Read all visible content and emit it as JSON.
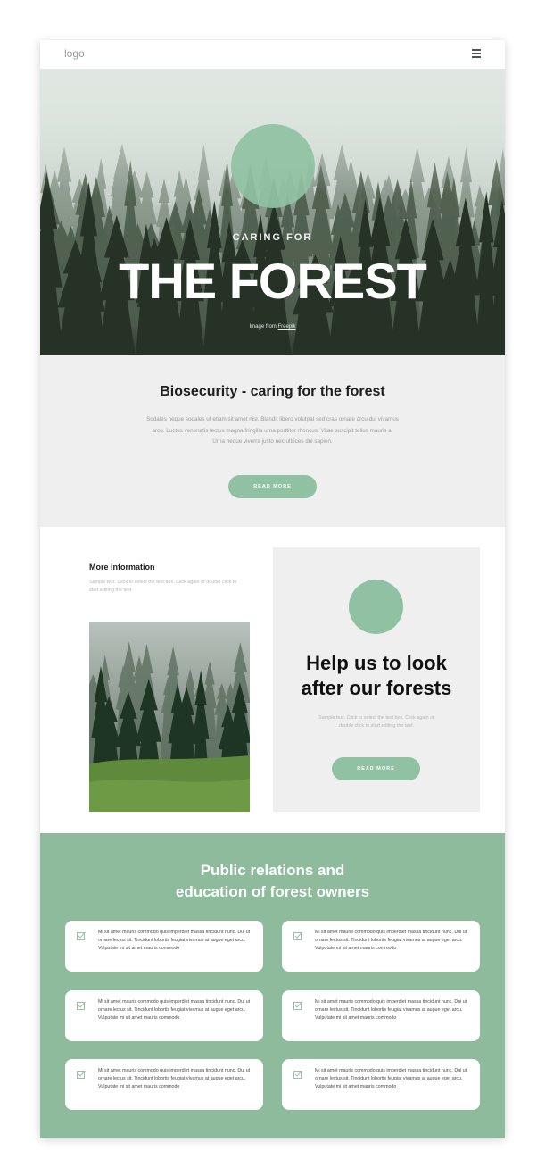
{
  "header": {
    "logo": "logo",
    "menu_icon": "hamburger-icon"
  },
  "hero": {
    "kicker": "CARING FOR",
    "title": "THE FOREST",
    "credit_prefix": "Image from",
    "credit_link": "Freepik"
  },
  "bio": {
    "title": "Biosecurity - caring for the forest",
    "text": "Sodales neque sodales ut etiam sit amet nisl. Blandit libero volutpat sed cras ornare arcu dui vivamus arcu. Luctus venenatis lectus magna fringilla urna porttitor rhoncus. Vitae suscipit tellus mauris a. Urna neque viverra justo nec ultrices dui sapien.",
    "button": "READ MORE"
  },
  "more": {
    "title": "More information",
    "text": "Sample text. Click to select the text box. Click again or double click to start editing the text."
  },
  "help": {
    "title_line1": "Help us to look",
    "title_line2": "after our forests",
    "text": "Sample text. Click to select the text box. Click again or double click to start editing the text.",
    "button": "READ MORE"
  },
  "pr": {
    "title_line1": "Public relations and",
    "title_line2": "education of forest owners",
    "card_icon": "checkbox-icon",
    "cards": [
      "Mi sit amet mauris commodo quis imperdiet massa tincidunt nunc. Dui ut ornare lectus sit. Tincidunt lobortis feugiat vivamus at augue eget arcu. Vulputate mi sit amet mauris commodo",
      "Mi sit amet mauris commodo quis imperdiet massa tincidunt nunc. Dui ut ornare lectus sit. Tincidunt lobortis feugiat vivamus at augue eget arcu. Vulputate mi sit amet mauris commodo",
      "Mi sit amet mauris commodo quis imperdiet massa tincidunt nunc. Dui ut ornare lectus sit. Tincidunt lobortis feugiat vivamus at augue eget arcu. Vulputate mi sit amet mauris commodo",
      "Mi sit amet mauris commodo quis imperdiet massa tincidunt nunc. Dui ut ornare lectus sit. Tincidunt lobortis feugiat vivamus at augue eget arcu. Vulputate mi sit amet mauris commodo",
      "Mi sit amet mauris commodo quis imperdiet massa tincidunt nunc. Dui ut ornare lectus sit. Tincidunt lobortis feugiat vivamus at augue eget arcu. Vulputate mi sit amet mauris commodo",
      "Mi sit amet mauris commodo quis imperdiet massa tincidunt nunc. Dui ut ornare lectus sit. Tincidunt lobortis feugiat vivamus at augue eget arcu. Vulputate mi sit amet mauris commodo"
    ]
  },
  "colors": {
    "accent": "#8fc1a2",
    "section_green": "#8fbb9d",
    "panel_gray": "#efefef"
  }
}
